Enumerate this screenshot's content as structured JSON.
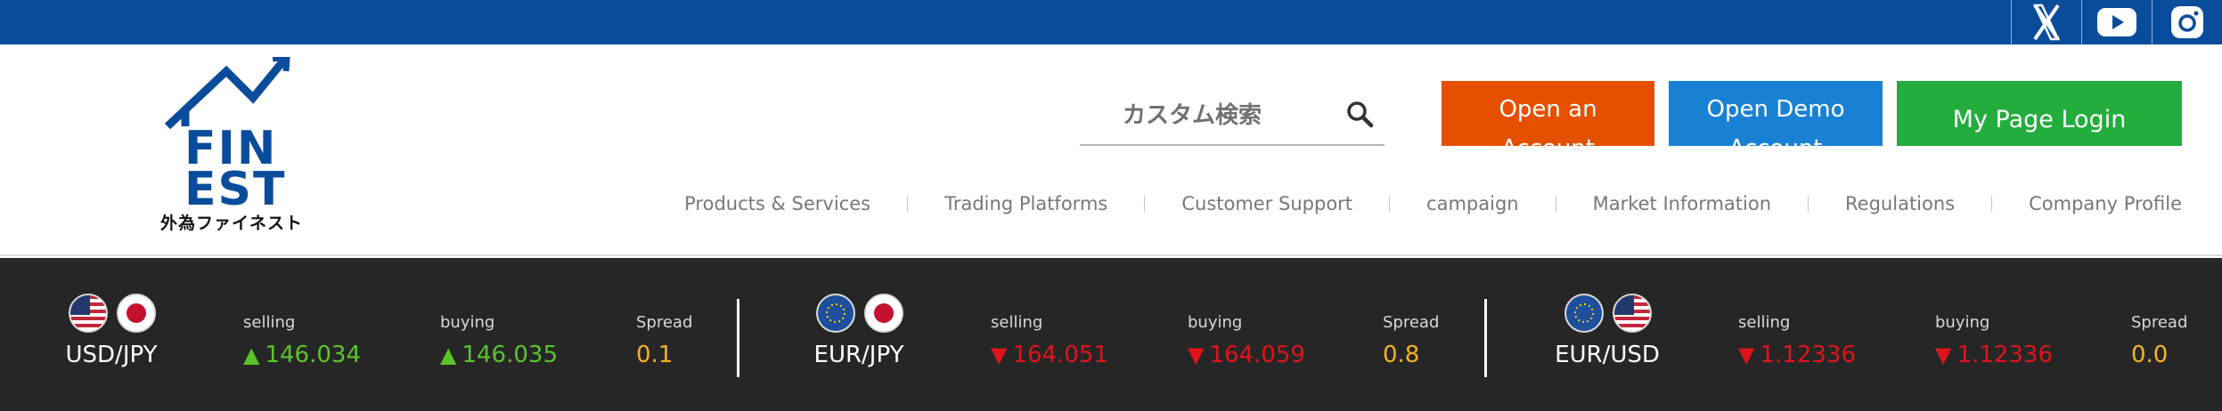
{
  "social": {
    "x_label": "X",
    "youtube_label": "YouTube",
    "instagram_label": "Instagram"
  },
  "logo": {
    "line1": "FIN",
    "line2": "EST",
    "subtitle": "外為ファイネスト"
  },
  "search": {
    "placeholder": "カスタム検索"
  },
  "buttons": {
    "open_account": "Open an Account",
    "open_demo": "Open Demo Account",
    "login": "My Page Login"
  },
  "nav": [
    {
      "label": "Products & Services"
    },
    {
      "label": "Trading Platforms"
    },
    {
      "label": "Customer Support"
    },
    {
      "label": "campaign"
    },
    {
      "label": "Market Information"
    },
    {
      "label": "Regulations"
    },
    {
      "label": "Company Profile"
    }
  ],
  "rates": [
    {
      "pair": "USD/JPY",
      "flags": [
        "us-flag-icon",
        "jp-flag-icon"
      ],
      "selling_label": "selling",
      "buying_label": "buying",
      "spread_label": "Spread",
      "selling": "146.034",
      "buying": "146.035",
      "spread": "0.1",
      "direction": "up"
    },
    {
      "pair": "EUR/JPY",
      "flags": [
        "eu-flag-icon",
        "jp-flag-icon"
      ],
      "selling_label": "selling",
      "buying_label": "buying",
      "spread_label": "Spread",
      "selling": "164.051",
      "buying": "164.059",
      "spread": "0.8",
      "direction": "down"
    },
    {
      "pair": "EUR/USD",
      "flags": [
        "eu-flag-icon",
        "us-flag-icon"
      ],
      "selling_label": "selling",
      "buying_label": "buying",
      "spread_label": "Spread",
      "selling": "1.12336",
      "buying": "1.12336",
      "spread": "0.0",
      "direction": "down"
    }
  ],
  "colors": {
    "brand_blue": "#0a4c9c",
    "account_orange": "#e45000",
    "demo_blue": "#1981d4",
    "login_green": "#22ad3c",
    "up_green": "#5ac42a",
    "down_red": "#e0141a",
    "spread_yellow": "#f4b324",
    "ticker_bg": "#262626"
  }
}
